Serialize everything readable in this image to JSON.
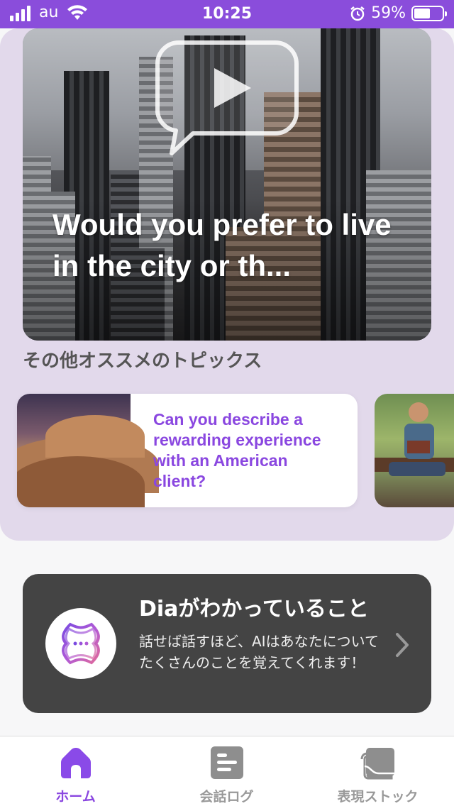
{
  "status_bar": {
    "carrier": "au",
    "time": "10:25",
    "battery": "59%",
    "battery_level": 0.59
  },
  "hero": {
    "title": "Would you prefer to live in the city or th..."
  },
  "recommended": {
    "heading": "その他オススメのトピックス",
    "topics": [
      {
        "text": "Can you describe a rewarding experience with an American client?"
      }
    ]
  },
  "dia": {
    "title": "Diaがわかっていること",
    "description": "話せば話すほど、AIはあなたについてたくさんのことを覚えてくれます！"
  },
  "tabs": [
    {
      "label": "ホーム",
      "icon": "home-icon",
      "active": true
    },
    {
      "label": "会話ログ",
      "icon": "conversation-log-icon",
      "active": false
    },
    {
      "label": "表現ストック",
      "icon": "expression-stock-icon",
      "active": false
    }
  ],
  "colors": {
    "accent": "#8a47e0",
    "panel": "#e2d9eb",
    "dia_card": "#444444"
  }
}
